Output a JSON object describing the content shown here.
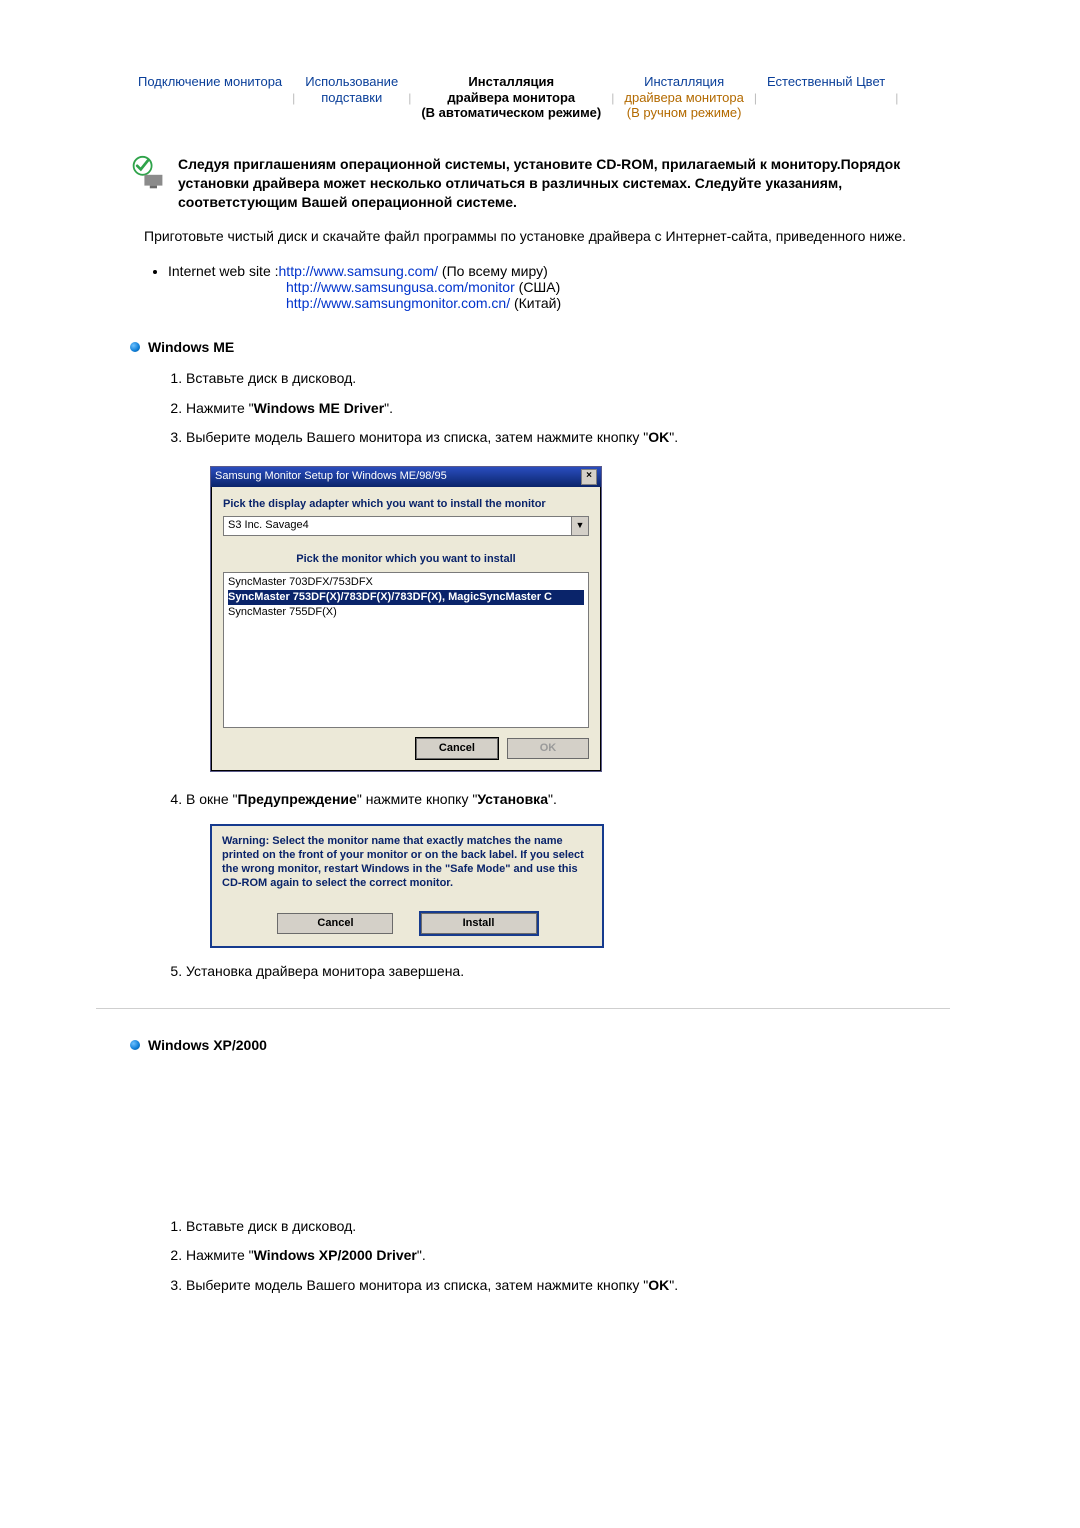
{
  "tabs": {
    "t1": "Подключение монитора",
    "t2a": "Использование",
    "t2b": "подставки",
    "t3a": "Инсталляция",
    "t3b": "драйвера монитора",
    "t3c": "(В автоматическом режиме)",
    "t4a": "Инсталляция",
    "t4b": "драйвера монитора",
    "t4c": "(В ручном режиме)",
    "t5": "Естественный Цвет"
  },
  "intro": {
    "bold": "Следуя приглашениям операционной системы, установите CD-ROM, прилагаемый к монитору.Порядок установки драйвера может несколько отличаться в различных системах. Следуйте указаниям, соответстующим Вашей операционной системе.",
    "para": "Приготовьте чистый диск и скачайте файл программы по установке драйвера с Интернет-сайта, приведенного ниже."
  },
  "links": {
    "label": "Internet web site :",
    "l1": "http://www.samsung.com/",
    "l1_sfx": " (По всему миру)",
    "l2": "http://www.samsungusa.com/monitor",
    "l2_sfx": " (США)",
    "l3": "http://www.samsungmonitor.com.cn/",
    "l3_sfx": " (Китай)"
  },
  "sec_me": {
    "title": "Windows ME",
    "step1": "Вставьте диск в дисковод.",
    "step2_a": "Нажмите \"",
    "step2_b": "Windows ME Driver",
    "step2_c": "\".",
    "step3_a": "Выберите модель Вашего монитора из списка, затем нажмите кнопку \"",
    "step3_b": "OK",
    "step3_c": "\".",
    "step4_a": "В окне \"",
    "step4_b": "Предупреждение",
    "step4_c": "\" нажмите кнопку \"",
    "step4_d": "Установка",
    "step4_e": "\".",
    "step5": "Установка драйвера монитора завершена."
  },
  "dlg1": {
    "title": "Samsung Monitor Setup for Windows ME/98/95",
    "lbl1": "Pick the display adapter which you want to install the monitor",
    "combo": "S3 Inc. Savage4",
    "lbl2": "Pick the monitor which you want to install",
    "item1": "SyncMaster 703DFX/753DFX",
    "item2": "SyncMaster 753DF(X)/783DF(X)/783DF(X), MagicSyncMaster C",
    "item3": "SyncMaster 755DF(X)",
    "btn_cancel": "Cancel",
    "btn_ok": "OK"
  },
  "dlg2": {
    "warn": "Warning: Select the monitor name that exactly matches the name printed on the front of your monitor or on the back label. If you select the wrong monitor, restart Windows in the \"Safe Mode\" and use this CD-ROM again to select the correct monitor.",
    "btn_cancel": "Cancel",
    "btn_install": "Install"
  },
  "sec_xp": {
    "title": "Windows XP/2000",
    "step1": "Вставьте диск в дисковод.",
    "step2_a": "Нажмите \"",
    "step2_b": "Windows XP/2000 Driver",
    "step2_c": "\".",
    "step3_a": "Выберите модель Вашего монитора из списка, затем нажмите кнопку \"",
    "step3_b": "OK",
    "step3_c": "\"."
  }
}
